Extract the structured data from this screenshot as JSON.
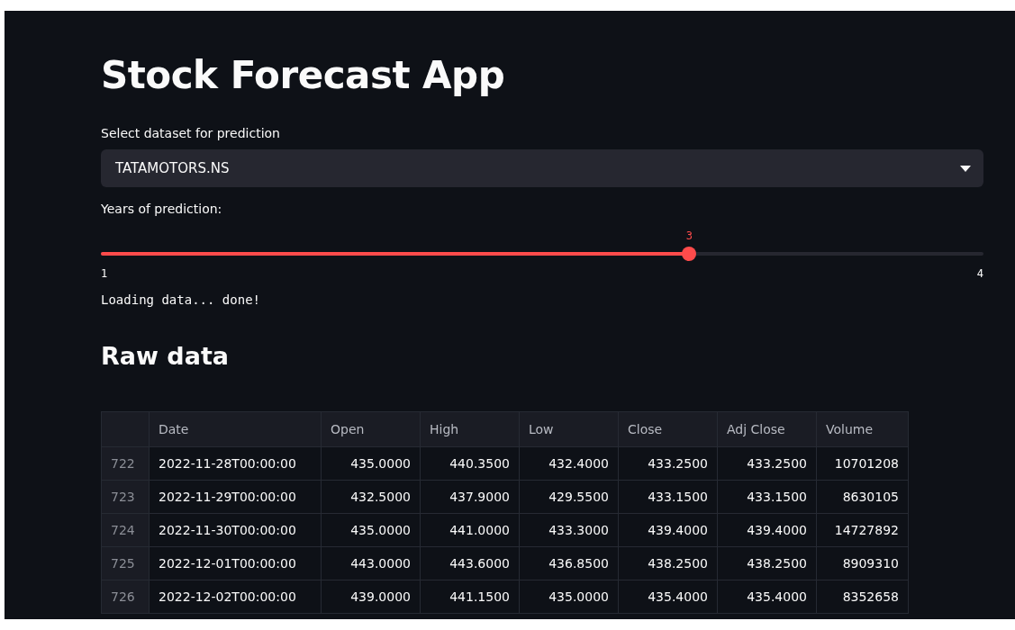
{
  "title": "Stock Forecast App",
  "dataset_select": {
    "label": "Select dataset for prediction",
    "value": "TATAMOTORS.NS"
  },
  "years_slider": {
    "label": "Years of prediction:",
    "value": "3",
    "min": "1",
    "max": "4",
    "level": 0.6667
  },
  "status": "Loading data... done!",
  "section_title": "Raw data",
  "table": {
    "columns": [
      "",
      "Date",
      "Open",
      "High",
      "Low",
      "Close",
      "Adj Close",
      "Volume"
    ],
    "rows": [
      [
        "722",
        "2022-11-28T00:00:00",
        "435.0000",
        "440.3500",
        "432.4000",
        "433.2500",
        "433.2500",
        "10701208"
      ],
      [
        "723",
        "2022-11-29T00:00:00",
        "432.5000",
        "437.9000",
        "429.5500",
        "433.1500",
        "433.1500",
        "8630105"
      ],
      [
        "724",
        "2022-11-30T00:00:00",
        "435.0000",
        "441.0000",
        "433.3000",
        "439.4000",
        "439.4000",
        "14727892"
      ],
      [
        "725",
        "2022-12-01T00:00:00",
        "443.0000",
        "443.6000",
        "436.8500",
        "438.2500",
        "438.2500",
        "8909310"
      ],
      [
        "726",
        "2022-12-02T00:00:00",
        "439.0000",
        "441.1500",
        "435.0000",
        "435.4000",
        "435.4000",
        "8352658"
      ]
    ]
  }
}
